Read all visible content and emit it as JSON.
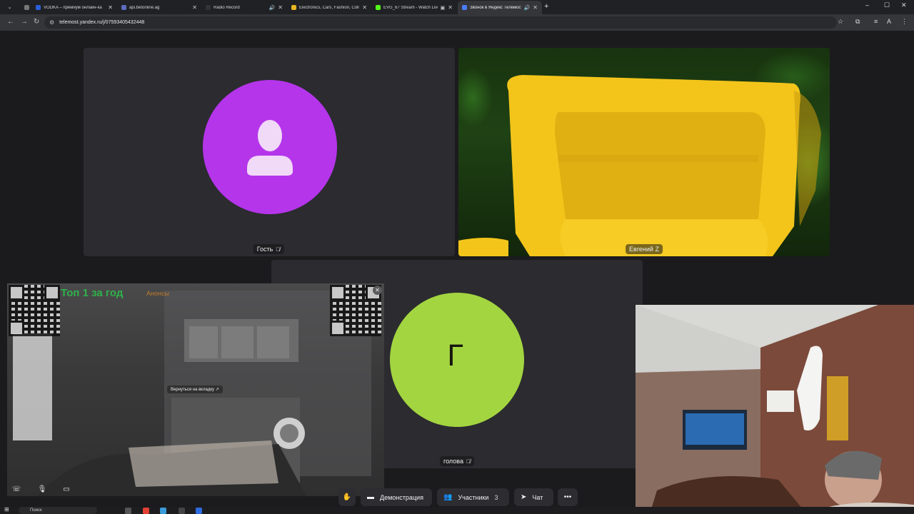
{
  "browser": {
    "tabs": [
      {
        "title": "VODKA – премиум онлайн-ка",
        "fav_color": "#2b5fd9",
        "sound": false
      },
      {
        "title": "api.betonline.ag",
        "fav_color": "#5c6bc0",
        "sound": false
      },
      {
        "title": "Radio Record",
        "fav_color": "#333333",
        "sound": true
      },
      {
        "title": "Electronics, Cars, Fashion, Colle",
        "fav_color": "#e7b521",
        "sound": false
      },
      {
        "title": "EVG_67 Stream - Watch Live",
        "fav_color": "#53fc18",
        "sound": true
      },
      {
        "title": "Звонок в Яндекс Телемост",
        "fav_color": "#4a7cff",
        "sound": true
      }
    ],
    "url": "telemost.yandex.ru/j/07593405432448"
  },
  "meeting": {
    "participants": [
      {
        "name": "Гость",
        "avatar_color": "#b535ea",
        "muted": true
      },
      {
        "name": "Евгений Z",
        "muted": false
      },
      {
        "name": "голова",
        "avatar_letter": "Г",
        "avatar_color": "#a3d540",
        "muted": true
      }
    ],
    "controls": {
      "demo_label": "Демонстрация",
      "participants_label": "Участники",
      "participants_count": "3",
      "chat_label": "Чат"
    }
  },
  "pip": {
    "top_text": "Топ 1 за год",
    "announce_text": "Анонсы",
    "back_to_tab": "Вернуться на вкладку"
  },
  "taskbar": {
    "search_placeholder": "Поиск"
  }
}
